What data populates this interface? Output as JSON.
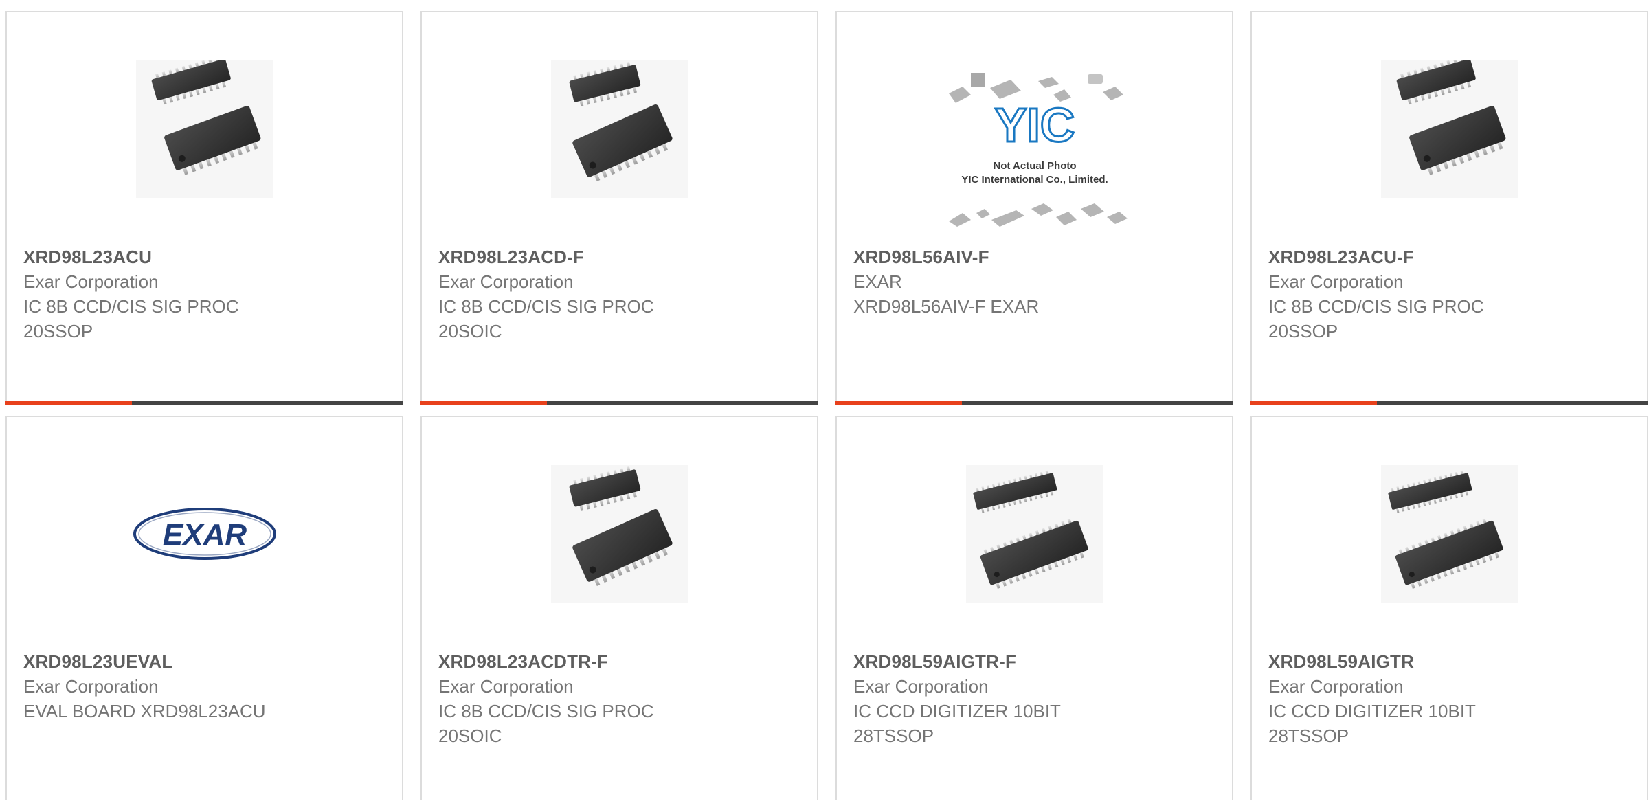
{
  "products": [
    {
      "part_number": "XRD98L23ACU",
      "manufacturer": "Exar Corporation",
      "description": "IC 8B CCD/CIS SIG PROC\n20SSOP",
      "image_icon": "ssop-20-chip-icon"
    },
    {
      "part_number": "XRD98L23ACD-F",
      "manufacturer": "Exar Corporation",
      "description": "IC 8B CCD/CIS SIG PROC\n20SOIC",
      "image_icon": "soic-20-chip-icon"
    },
    {
      "part_number": "XRD98L56AIV-F",
      "manufacturer": "EXAR",
      "description": "XRD98L56AIV-F EXAR",
      "image_icon": "placeholder-photo-icon",
      "image_caption": [
        "Not Actual Photo",
        "YIC International Co., Limited."
      ],
      "image_logo": "YIC"
    },
    {
      "part_number": "XRD98L23ACU-F",
      "manufacturer": "Exar Corporation",
      "description": "IC 8B CCD/CIS SIG PROC\n20SSOP",
      "image_icon": "ssop-20-chip-icon"
    },
    {
      "part_number": "XRD98L23UEVAL",
      "manufacturer": "Exar Corporation",
      "description": "EVAL BOARD XRD98L23ACU",
      "image_icon": "exar-logo-icon",
      "image_logo": "EXAR"
    },
    {
      "part_number": "XRD98L23ACDTR-F",
      "manufacturer": "Exar Corporation",
      "description": "IC 8B CCD/CIS SIG PROC\n20SOIC",
      "image_icon": "soic-20-chip-icon"
    },
    {
      "part_number": "XRD98L59AIGTR-F",
      "manufacturer": "Exar Corporation",
      "description": "IC CCD DIGITIZER 10BIT\n28TSSOP",
      "image_icon": "tssop-28-chip-icon"
    },
    {
      "part_number": "XRD98L59AIGTR",
      "manufacturer": "Exar Corporation",
      "description": "IC CCD DIGITIZER 10BIT\n28TSSOP",
      "image_icon": "tssop-28-chip-icon"
    }
  ],
  "colors": {
    "accent": "#e8411c",
    "bar_dark": "#444444",
    "card_border": "#dcdcdc",
    "part_number": "#5e5e5e",
    "text_muted": "#757575",
    "exar_blue": "#1f3d7a",
    "yic_blue": "#1a78c2"
  }
}
